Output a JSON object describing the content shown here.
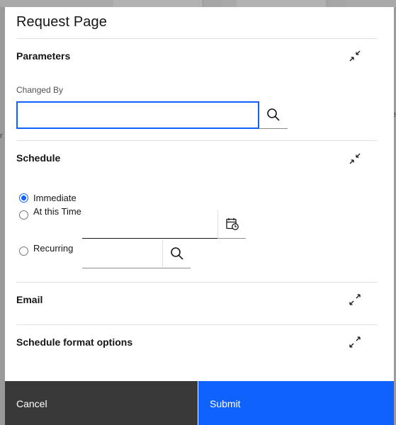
{
  "modal": {
    "title": "Request Page"
  },
  "background": {
    "left_fragment": "r",
    "right_fragment": "e"
  },
  "parameters": {
    "title": "Parameters",
    "toggle_icon": "minimize-icon",
    "changed_by": {
      "label": "Changed By",
      "value": "",
      "search_icon": "search-icon"
    }
  },
  "schedule": {
    "title": "Schedule",
    "toggle_icon": "minimize-icon",
    "options": [
      {
        "label": "Immediate",
        "checked": true
      },
      {
        "label": "At this Time",
        "checked": false
      },
      {
        "label": "Recurring",
        "checked": false
      }
    ],
    "time_value": "",
    "time_icon": "calendar-clock-icon",
    "recurring_value": "",
    "recurring_icon": "search-icon"
  },
  "email": {
    "title": "Email",
    "toggle_icon": "maximize-icon"
  },
  "format_options": {
    "title": "Schedule format options",
    "toggle_icon": "maximize-icon"
  },
  "footer": {
    "cancel_label": "Cancel",
    "submit_label": "Submit"
  },
  "colors": {
    "primary": "#0f62fe",
    "secondary_button": "#393939",
    "text": "#161616",
    "label": "#525252",
    "divider": "#e0e0e0"
  }
}
